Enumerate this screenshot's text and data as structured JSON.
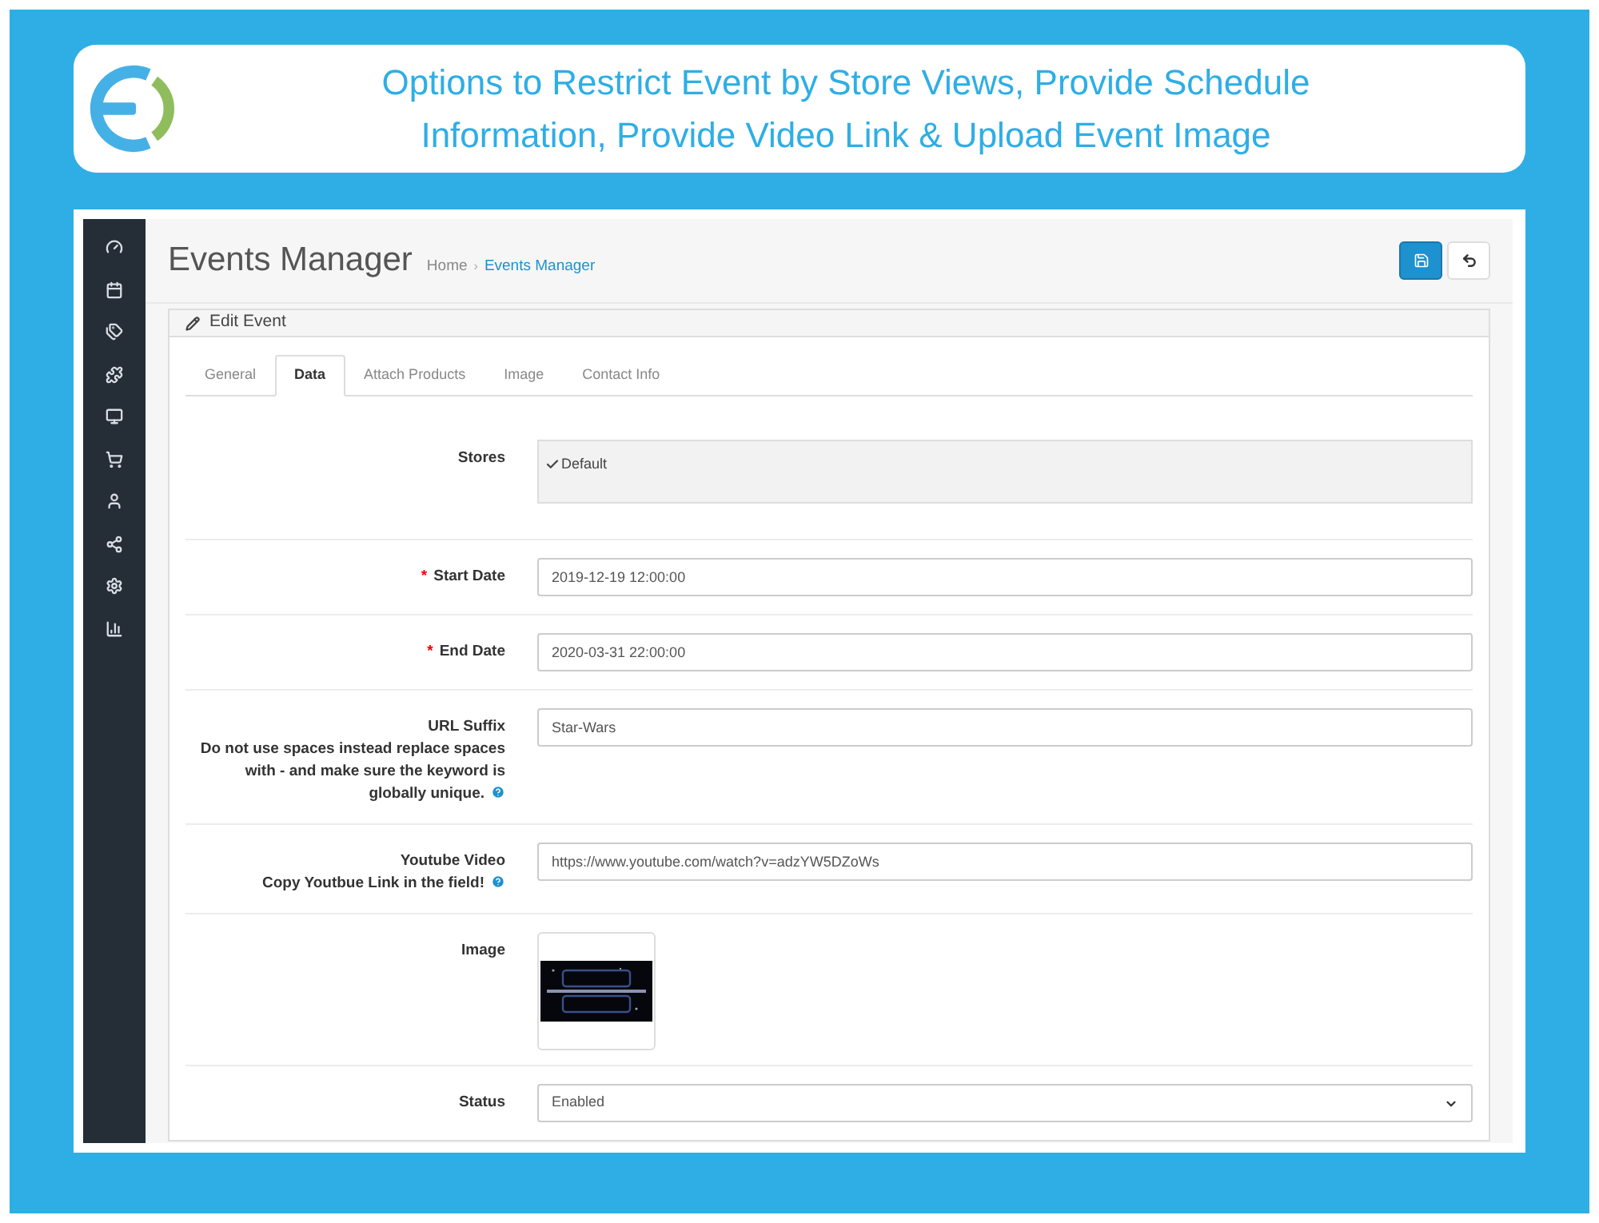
{
  "banner": {
    "title": "Options to Restrict Event by Store Views, Provide Schedule Information, Provide Video Link & Upload Event Image"
  },
  "required_mark": "*",
  "page": {
    "title": "Events Manager",
    "separator": "›",
    "breadcrumbs": [
      {
        "label": "Home",
        "selected": false
      },
      {
        "label": "Events Manager",
        "selected": true
      }
    ]
  },
  "panel": {
    "title": "Edit Event"
  },
  "tabs": [
    {
      "label": "General",
      "selected": false
    },
    {
      "label": "Data",
      "selected": true
    },
    {
      "label": "Attach Products",
      "selected": false
    },
    {
      "label": "Image",
      "selected": false
    },
    {
      "label": "Contact Info",
      "selected": false
    }
  ],
  "fields": [
    {
      "kind": "stores",
      "label": "Stores",
      "required": false,
      "options": [
        {
          "label": "Default",
          "checked": true
        }
      ]
    },
    {
      "kind": "text",
      "label": "Start Date",
      "required": true,
      "value": "2019-12-19 12:00:00"
    },
    {
      "kind": "text",
      "label": "End Date",
      "required": true,
      "value": "2020-03-31 22:00:00"
    },
    {
      "kind": "text",
      "label": "URL Suffix",
      "help": "Do not use spaces instead replace spaces with - and make sure the keyword is globally unique.",
      "required": false,
      "value": "Star-Wars"
    },
    {
      "kind": "text",
      "label": "Youtube Video",
      "help": "Copy Youtbue Link in the field!",
      "required": false,
      "value": "https://www.youtube.com/watch?v=adzYW5DZoWs"
    },
    {
      "label": "Image",
      "required": false
    },
    {
      "kind": "select",
      "label": "Status",
      "required": false,
      "value": "Enabled"
    }
  ]
}
